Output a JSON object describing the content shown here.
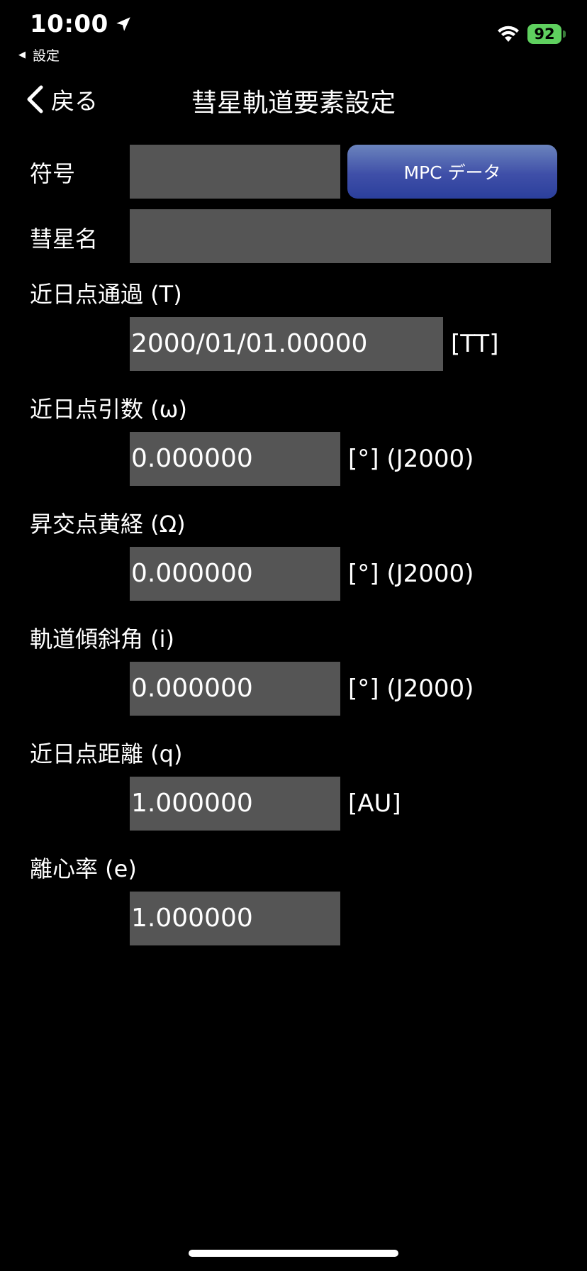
{
  "status_bar": {
    "time": "10:00",
    "back_app": "設定",
    "battery": "92"
  },
  "nav": {
    "back_label": "戻る",
    "title": "彗星軌道要素設定"
  },
  "form": {
    "code": {
      "label": "符号",
      "value": ""
    },
    "mpc_button": "MPC データ",
    "name": {
      "label": "彗星名",
      "value": ""
    },
    "perihelion_time": {
      "label": "近日点通過 (T)",
      "value": "2000/01/01.00000",
      "unit": "[TT]"
    },
    "arg_perihelion": {
      "label": "近日点引数 (ω)",
      "value": "0.000000",
      "unit": "[°] (J2000)"
    },
    "long_asc_node": {
      "label": "昇交点黄経 (Ω)",
      "value": "0.000000",
      "unit": "[°] (J2000)"
    },
    "inclination": {
      "label": "軌道傾斜角 (i)",
      "value": "0.000000",
      "unit": "[°] (J2000)"
    },
    "perihelion_distance": {
      "label": "近日点距離 (q)",
      "value": "1.000000",
      "unit": "[AU]"
    },
    "eccentricity": {
      "label": "離心率 (e)",
      "value": "1.000000"
    }
  }
}
